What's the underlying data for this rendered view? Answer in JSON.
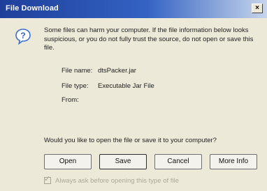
{
  "window": {
    "title": "File Download",
    "close_label": "×"
  },
  "message": "Some files can harm your computer. If the file information below looks suspicious, or you do not fully trust the source, do not open or save this file.",
  "file_info": {
    "name_label": "File name:",
    "name_value": "dtsPacker.jar",
    "type_label": "File type:",
    "type_value": "Executable Jar File",
    "from_label": "From:",
    "from_value": ""
  },
  "question": "Would you like to open the file or save it to your computer?",
  "buttons": {
    "open": "Open",
    "save": "Save",
    "cancel": "Cancel",
    "more_info": "More Info"
  },
  "always_ask": {
    "label": "Always ask before opening this type of file",
    "checked": true,
    "check_glyph": "✓"
  },
  "colors": {
    "title_bar_start": "#1f3f9a",
    "title_bar_end": "#c6d5ea",
    "dialog_bg": "#ece9d8",
    "icon_blue": "#2b5fc9"
  },
  "icons": {
    "question": "question-mark-bubble"
  }
}
